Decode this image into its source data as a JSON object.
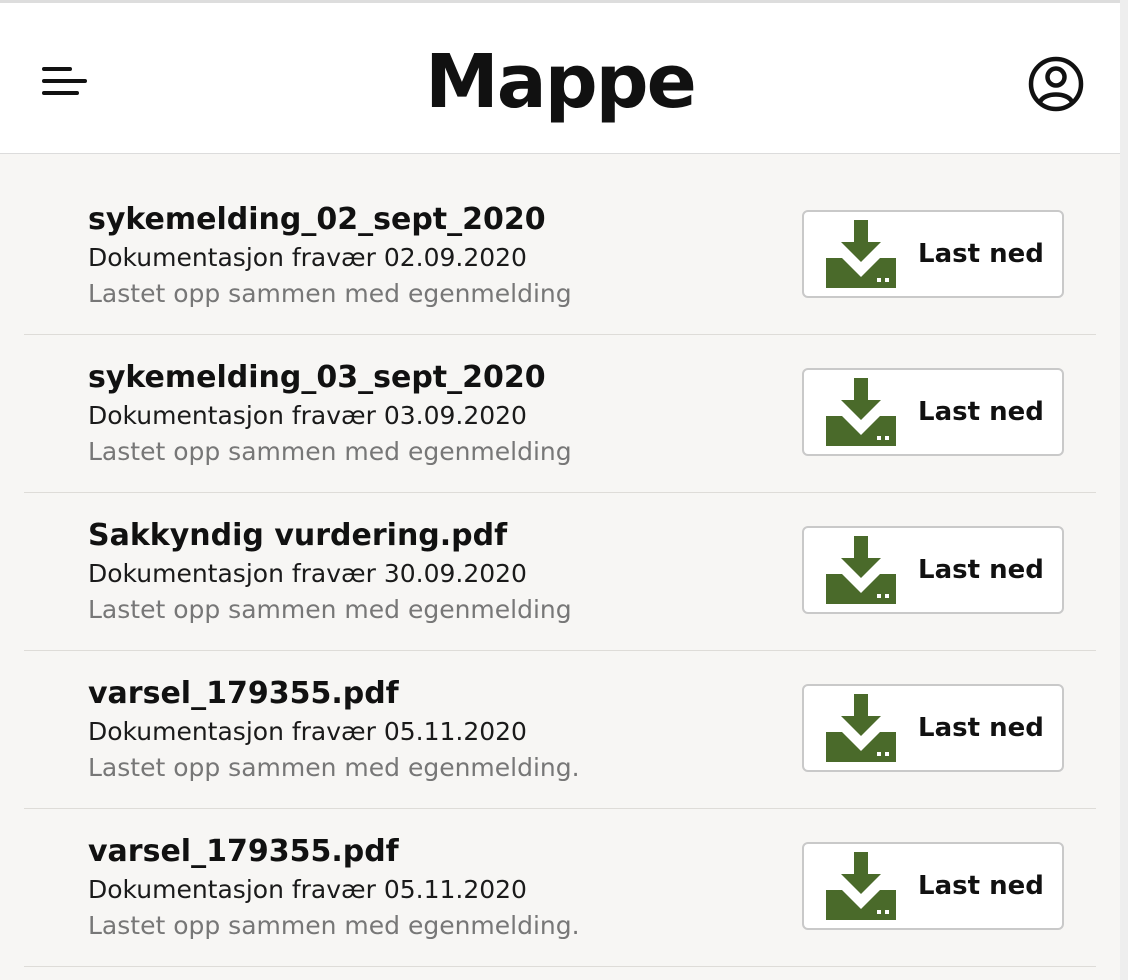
{
  "header": {
    "title": "Mappe",
    "menu_icon": "hamburger-menu-icon",
    "user_icon": "user-account-icon"
  },
  "colors": {
    "accent": "#4a6a2a",
    "background": "#f7f6f4",
    "header_background": "#ffffff"
  },
  "documents": [
    {
      "name": "sykemelding_02_sept_2020",
      "description": "Dokumentasjon fravær 02.09.2020",
      "note": "Lastet opp sammen med egenmelding",
      "button_label": "Last ned"
    },
    {
      "name": "sykemelding_03_sept_2020",
      "description": "Dokumentasjon fravær 03.09.2020",
      "note": "Lastet opp sammen med egenmelding",
      "button_label": "Last ned"
    },
    {
      "name": "Sakkyndig vurdering.pdf",
      "description": "Dokumentasjon fravær 30.09.2020",
      "note": "Lastet opp sammen med egenmelding",
      "button_label": "Last ned"
    },
    {
      "name": "varsel_179355.pdf",
      "description": "Dokumentasjon fravær 05.11.2020",
      "note": "Lastet opp sammen med egenmelding.",
      "button_label": "Last ned"
    },
    {
      "name": "varsel_179355.pdf",
      "description": "Dokumentasjon fravær 05.11.2020",
      "note": "Lastet opp sammen med egenmelding.",
      "button_label": "Last ned"
    }
  ]
}
